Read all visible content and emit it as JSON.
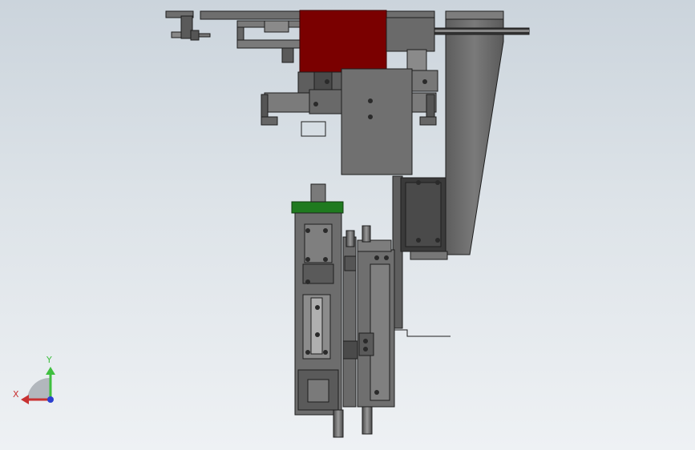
{
  "viewport": {
    "background_top": "#cbd4dc",
    "background_bottom": "#eef1f4"
  },
  "model": {
    "part_colors": {
      "body": "#6e6e6e",
      "body_dark": "#4f4f4f",
      "outline": "#1e1e1e",
      "highlight_red": "#7a0000",
      "highlight_green": "#1f7a1f",
      "motor": "#3a3a3a"
    }
  },
  "triad": {
    "x_label": "X",
    "y_label": "Y",
    "x_color": "#c83232",
    "y_color": "#3fbf3f",
    "z_color": "#2b3fcf"
  }
}
